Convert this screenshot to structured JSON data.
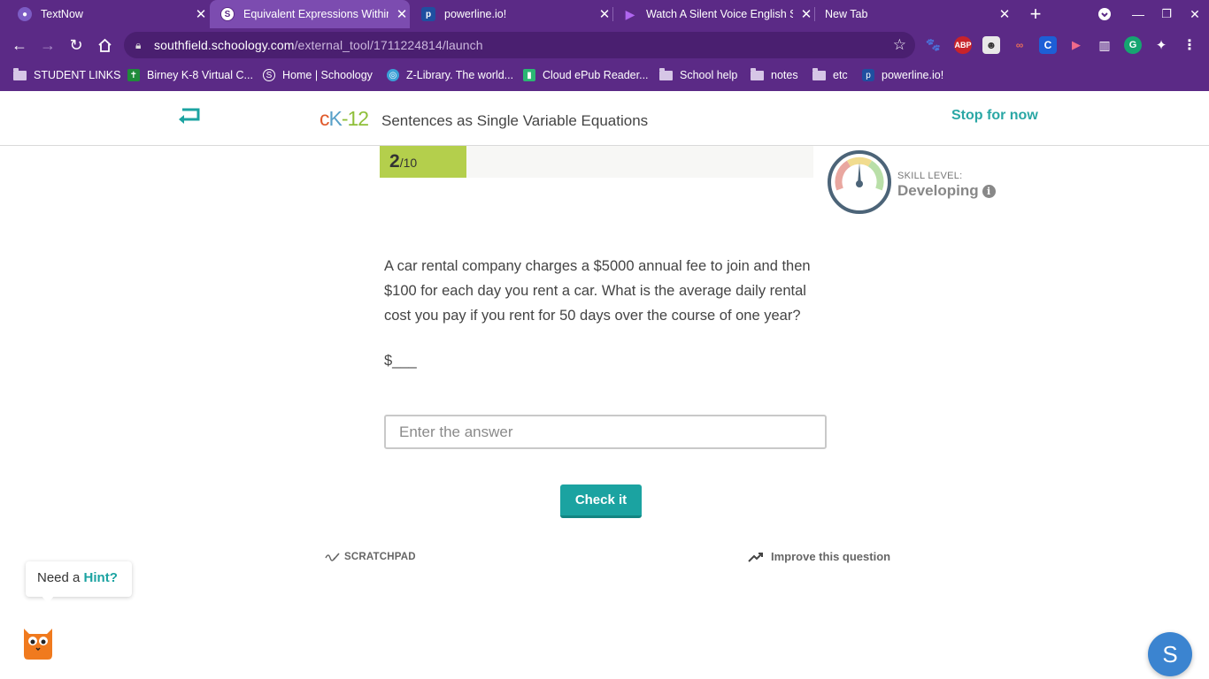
{
  "browser": {
    "tabs": [
      {
        "title": "TextNow",
        "icon": "textnow-icon"
      },
      {
        "title": "Equivalent Expressions Within",
        "icon": "schoology-icon"
      },
      {
        "title": "powerline.io!",
        "icon": "powerline-icon"
      },
      {
        "title": "Watch A Silent Voice English S",
        "icon": "play-icon"
      },
      {
        "title": "New Tab",
        "icon": ""
      }
    ],
    "url_host": "southfield.schoology.com",
    "url_path": "/external_tool/1711224814/launch",
    "extensions": [
      "ABP",
      "C"
    ],
    "bookmarks": [
      {
        "label": "STUDENT LINKS",
        "type": "folder"
      },
      {
        "label": "Birney K-8 Virtual C...",
        "type": "link"
      },
      {
        "label": "Home | Schoology",
        "type": "link"
      },
      {
        "label": "Z-Library. The world...",
        "type": "link"
      },
      {
        "label": "Cloud ePub Reader...",
        "type": "link"
      },
      {
        "label": "School help",
        "type": "folder"
      },
      {
        "label": "notes",
        "type": "folder"
      },
      {
        "label": "etc",
        "type": "folder"
      },
      {
        "label": "powerline.io!",
        "type": "link"
      }
    ]
  },
  "page": {
    "logo": "cK-12",
    "lesson_title": "Sentences as Single Variable Equations",
    "stop_label": "Stop for now",
    "progress": {
      "current": "2",
      "total": "/10",
      "fraction": 0.2
    },
    "skill": {
      "label": "SKILL LEVEL:",
      "value": "Developing"
    },
    "question": "A car rental company charges a $5000 annual fee to join and then $100 for each day you rent a car. What is the average daily rental cost you pay if you rent for 50 days over the course of one year?",
    "blank": "$___",
    "answer_placeholder": "Enter the answer",
    "check_label": "Check it",
    "scratchpad_label": "SCRATCHPAD",
    "improve_label": "Improve this question",
    "hint_prefix": "Need a ",
    "hint_link": "Hint?",
    "schoology_letter": "S"
  },
  "colors": {
    "chrome": "#5b2a86",
    "accent": "#1ba3a1",
    "progress_fill": "#b4cf4c"
  }
}
